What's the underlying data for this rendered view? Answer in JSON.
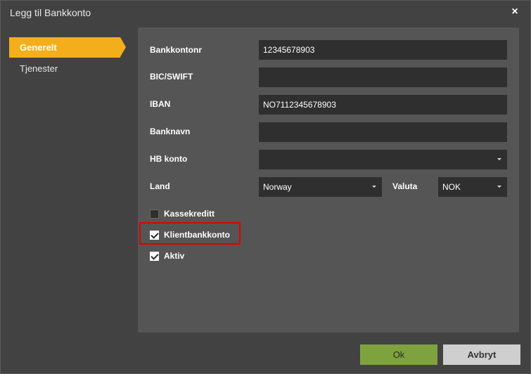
{
  "dialog": {
    "title": "Legg til Bankkonto",
    "close_glyph": "×"
  },
  "sidebar": {
    "items": [
      {
        "label": "Generelt",
        "active": true
      },
      {
        "label": "Tjenester",
        "active": false
      }
    ]
  },
  "form": {
    "bankkontonr": {
      "label": "Bankkontonr",
      "value": "12345678903"
    },
    "bic": {
      "label": "BIC/SWIFT",
      "value": ""
    },
    "iban": {
      "label": "IBAN",
      "value": "NO7112345678903"
    },
    "banknavn": {
      "label": "Banknavn",
      "value": ""
    },
    "hb_konto": {
      "label": "HB konto",
      "value": ""
    },
    "land": {
      "label": "Land",
      "value": "Norway"
    },
    "valuta": {
      "label": "Valuta",
      "value": "NOK"
    },
    "checkboxes": [
      {
        "label": "Kassekreditt",
        "checked": false
      },
      {
        "label": "Klientbankkonto",
        "checked": true,
        "highlighted": true
      },
      {
        "label": "Aktiv",
        "checked": true
      }
    ]
  },
  "buttons": {
    "ok_label": "Ok",
    "cancel_label": "Avbryt"
  },
  "colors": {
    "accent": "#f4ae1b",
    "ok_button": "#7ea33e",
    "highlight": "#e00000"
  }
}
